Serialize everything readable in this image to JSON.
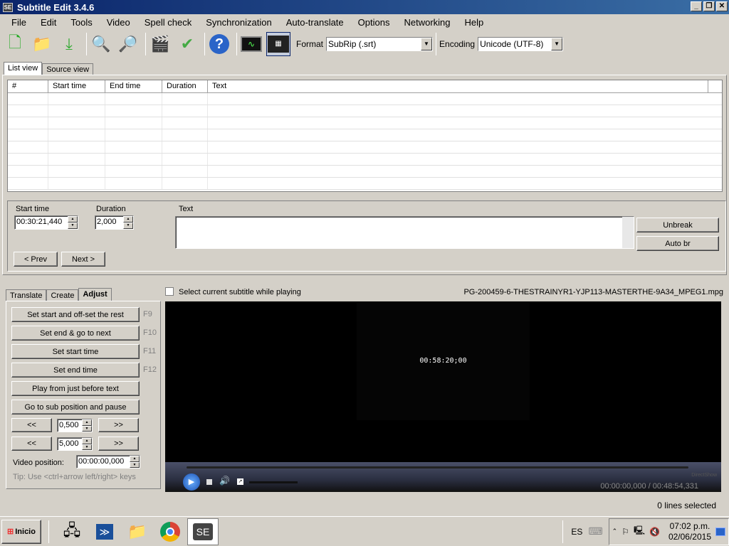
{
  "window": {
    "title": "Subtitle Edit 3.4.6",
    "app_icon": "SE",
    "minimize": "_",
    "restore": "❐",
    "close": "✕"
  },
  "menu": [
    "File",
    "Edit",
    "Tools",
    "Video",
    "Spell check",
    "Synchronization",
    "Auto-translate",
    "Options",
    "Networking",
    "Help"
  ],
  "toolbar": {
    "format_label": "Format",
    "format_value": "SubRip (.srt)",
    "encoding_label": "Encoding",
    "encoding_value": "Unicode (UTF-8)"
  },
  "tabs": [
    "List view",
    "Source view"
  ],
  "grid": {
    "columns": [
      "#",
      "Start time",
      "End time",
      "Duration",
      "Text"
    ]
  },
  "edit": {
    "start_time_label": "Start time",
    "start_time": "00:30:21,440",
    "duration_label": "Duration",
    "duration": "2,000",
    "text_label": "Text",
    "unbreak": "Unbreak",
    "auto_br": "Auto br",
    "prev": "< Prev",
    "next": "Next >"
  },
  "lower_tabs": [
    "Translate",
    "Create",
    "Adjust"
  ],
  "adjust": {
    "buttons": [
      {
        "label": "Set start and off-set the rest",
        "key": "F9"
      },
      {
        "label": "Set end & go to next",
        "key": "F10"
      },
      {
        "label": "Set start time",
        "key": "F11"
      },
      {
        "label": "Set end time",
        "key": "F12"
      },
      {
        "label": "Play from just before text",
        "key": ""
      },
      {
        "label": "Go to sub position and pause",
        "key": ""
      }
    ],
    "step_back": "<<",
    "step_fwd": ">>",
    "step1": "0,500",
    "step2": "5,000",
    "video_pos_label": "Video position:",
    "video_pos": "00:00:00,000",
    "tip": "Tip: Use <ctrl+arrow left/right> keys"
  },
  "video": {
    "select_checkbox_label": "Select current subtitle while playing",
    "file": "PG-200459-6-THESTRAINYR1-YJP113-MASTERTHE-9A34_MPEG1.mpg",
    "frame_timecode": "00:58:20;00",
    "time": "00:00:00,000 / 00:48:54,331",
    "engine": "DirectShow"
  },
  "status": "0 lines selected",
  "taskbar": {
    "start": "Inicio",
    "lang": "ES",
    "clock_time": "07:02 p.m.",
    "clock_date": "02/06/2015"
  }
}
